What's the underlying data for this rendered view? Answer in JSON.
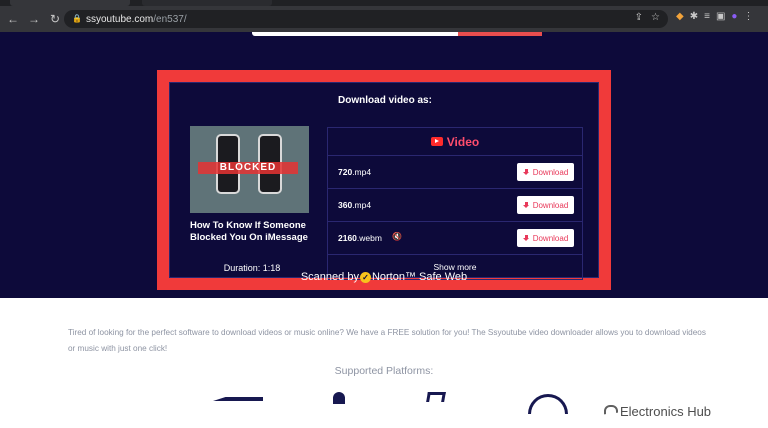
{
  "browser": {
    "url_host": "ssyoutube.com",
    "url_path": "/en537/"
  },
  "panel": {
    "title": "Download video as:",
    "video": {
      "thumbnail_overlay_text": "BLOCKED",
      "title": "How To Know If Someone Blocked You On iMessage",
      "duration": "Duration: 1:18"
    },
    "tab_label": "Video",
    "formats": [
      {
        "resolution": "720",
        "ext": ".mp4",
        "muted": false,
        "button_label": "Download"
      },
      {
        "resolution": "360",
        "ext": ".mp4",
        "muted": false,
        "button_label": "Download"
      },
      {
        "resolution": "2160",
        "ext": ".webm",
        "muted": true,
        "button_label": "Download"
      }
    ],
    "show_more_label": "Show more"
  },
  "scanned": {
    "prefix": "Scanned by",
    "brand": "Norton™ Safe Web"
  },
  "intro_text": "Tired of looking for the perfect software to download videos or music online? We have a FREE solution for you! The Ssyoutube video downloader allows you to download videos or music with just one click!",
  "supported_platforms_label": "Supported Platforms:",
  "watermark": "Electronics Hub",
  "colors": {
    "hero_bg": "#0d0a3a",
    "highlight_frame": "#f03a3a",
    "accent": "#e8395a"
  }
}
